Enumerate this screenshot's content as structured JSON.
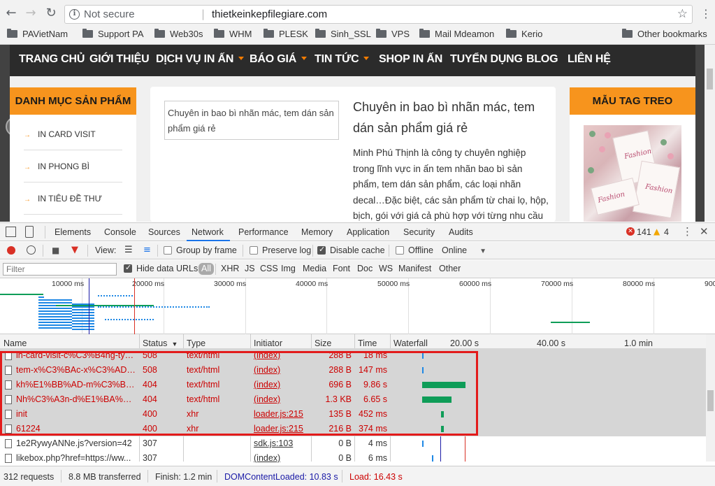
{
  "browser": {
    "security_label": "Not secure",
    "url": "thietkeinkepfilegiare.com",
    "bookmarks": [
      "PAVietNam",
      "Support PA",
      "Web30s",
      "WHM",
      "PLESK",
      "Sinh_SSL",
      "VPS",
      "Mail Mdeamon",
      "Kerio"
    ],
    "other_bookmarks": "Other bookmarks"
  },
  "site": {
    "nav": [
      {
        "label": "TRANG CHỦ",
        "dropdown": false
      },
      {
        "label": "GIỚI THIỆU",
        "dropdown": false
      },
      {
        "label": "DỊCH VỤ IN ẤN",
        "dropdown": true
      },
      {
        "label": "BÁO GIÁ",
        "dropdown": true
      },
      {
        "label": "TIN TỨC",
        "dropdown": true
      },
      {
        "label": "SHOP IN ẤN",
        "dropdown": false
      },
      {
        "label": "TUYỂN DỤNG",
        "dropdown": false
      },
      {
        "label": "BLOG",
        "dropdown": false
      },
      {
        "label": "LIÊN HỆ",
        "dropdown": false
      }
    ],
    "left_heading": "DANH MỤC SẢN PHẨM",
    "categories": [
      "IN CARD VISIT",
      "IN PHONG BÌ",
      "IN TIÊU ĐỀ THƯ"
    ],
    "image_alt": "Chuyên in bao bì nhãn mác, tem dán sản phẩm giá rẻ",
    "post_title": "Chuyên in bao bì nhãn mác, tem dán sản phẩm giá rẻ",
    "post_body": "Minh Phú Thịnh là công ty chuyên nghiệp trong lĩnh vực in ấn tem nhãn bao bì sản phẩm, tem dán sản phẩm, các loại nhãn decal…Đặc biệt, các sản phẩm từ chai lọ, hộp, bịch, gói với giá cả phù hợp với từng nhu cầu sử dụng của",
    "right_heading": "MẪU TAG TREO",
    "tag_text": "Fashion"
  },
  "devtools": {
    "tabs": [
      "Elements",
      "Console",
      "Sources",
      "Network",
      "Performance",
      "Memory",
      "Application",
      "Security",
      "Audits"
    ],
    "active_tab": "Network",
    "error_count": "141",
    "warning_count": "4",
    "toolbar": {
      "view_label": "View:",
      "group_by_frame": "Group by frame",
      "preserve_log": "Preserve log",
      "disable_cache": "Disable cache",
      "offline": "Offline",
      "throttle": "Online"
    },
    "filter": {
      "placeholder": "Filter",
      "hide_data_urls": "Hide data URLs",
      "types": [
        "All",
        "XHR",
        "JS",
        "CSS",
        "Img",
        "Media",
        "Font",
        "Doc",
        "WS",
        "Manifest",
        "Other"
      ]
    },
    "overview_ticks": [
      "10000 ms",
      "20000 ms",
      "30000 ms",
      "40000 ms",
      "50000 ms",
      "60000 ms",
      "70000 ms",
      "80000 ms",
      "900"
    ],
    "columns": {
      "name": "Name",
      "status": "Status",
      "type": "Type",
      "initiator": "Initiator",
      "size": "Size",
      "time": "Time",
      "waterfall": "Waterfall",
      "wf_ticks": [
        "20.00 s",
        "40.00 s",
        "1.0 min"
      ]
    },
    "rows": [
      {
        "name": "in-card-visit-c%C3%B4ng-ty-t...",
        "status": "508",
        "type": "text/html",
        "initiator": "(index)",
        "size": "288 B",
        "time": "18 ms",
        "error": true,
        "bar_start": 0.0,
        "bar_len": 0.02,
        "bar_color": "#1e88e5"
      },
      {
        "name": "tem-x%C3%BAc-x%C3%ADc...",
        "status": "508",
        "type": "text/html",
        "initiator": "(index)",
        "size": "288 B",
        "time": "147 ms",
        "error": true,
        "bar_start": 0.0,
        "bar_len": 0.02,
        "bar_color": "#1e88e5"
      },
      {
        "name": "kh%E1%BB%AD-m%C3%B9i-...",
        "status": "404",
        "type": "text/html",
        "initiator": "(index)",
        "size": "696 B",
        "time": "9.86 s",
        "error": true,
        "bar_start": 0.0,
        "bar_len": 0.62,
        "bar_color": "#0f9d58"
      },
      {
        "name": "Nh%C3%A3n-d%E1%BA%A7...",
        "status": "404",
        "type": "text/html",
        "initiator": "(index)",
        "size": "1.3 KB",
        "time": "6.65 s",
        "error": true,
        "bar_start": 0.0,
        "bar_len": 0.42,
        "bar_color": "#0f9d58"
      },
      {
        "name": "init",
        "status": "400",
        "type": "xhr",
        "initiator": "loader.js:215",
        "size": "135 B",
        "time": "452 ms",
        "error": true,
        "bar_start": 0.27,
        "bar_len": 0.04,
        "bar_color": "#0f9d58"
      },
      {
        "name": "61224",
        "status": "400",
        "type": "xhr",
        "initiator": "loader.js:215",
        "size": "216 B",
        "time": "374 ms",
        "error": true,
        "bar_start": 0.27,
        "bar_len": 0.04,
        "bar_color": "#0f9d58"
      },
      {
        "name": "1e2RywyANNe.js?version=42",
        "status": "307",
        "type": "",
        "initiator": "sdk.js:103",
        "size": "0 B",
        "time": "4 ms",
        "error": false,
        "bar_start": 0.0,
        "bar_len": 0.02,
        "bar_color": "#1e88e5"
      },
      {
        "name": "likebox.php?href=https://ww...",
        "status": "307",
        "type": "",
        "initiator": "(index)",
        "size": "0 B",
        "time": "6 ms",
        "error": false,
        "bar_start": 0.14,
        "bar_len": 0.02,
        "bar_color": "#1e88e5"
      }
    ],
    "status": {
      "requests": "312 requests",
      "transferred": "8.8 MB transferred",
      "finish": "Finish: 1.2 min",
      "dom": "DOMContentLoaded: 10.83 s",
      "load": "Load: 16.43 s"
    },
    "colors": {
      "dom_blue": "#1a1aa6",
      "load_red": "#c00",
      "highlight": "#e31b1b"
    }
  }
}
